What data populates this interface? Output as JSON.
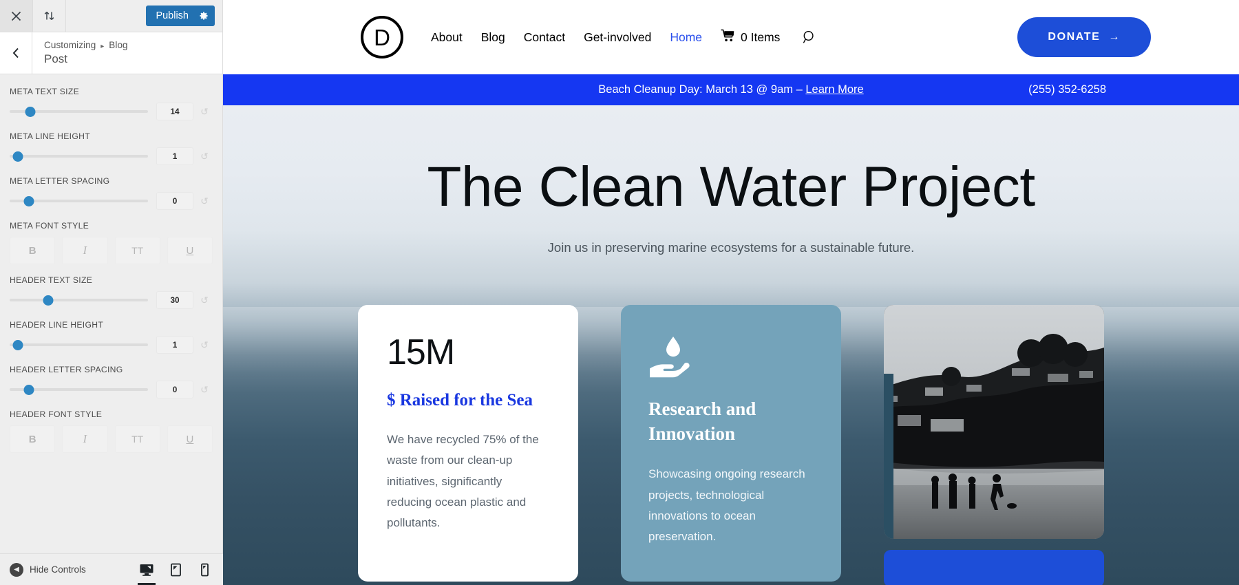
{
  "customizer": {
    "topbar": {
      "close_icon": "close-icon",
      "devices_icon": "collapse-expand-icon",
      "publish_label": "Publish",
      "gear_icon": "gear-icon"
    },
    "header": {
      "back_icon": "chevron-left-icon",
      "breadcrumb_root": "Customizing",
      "breadcrumb_separator": "▸",
      "breadcrumb_current": "Blog",
      "section_title": "Post"
    },
    "controls": [
      {
        "label": "META TEXT SIZE",
        "value": "14",
        "knob_pct": 15
      },
      {
        "label": "META LINE HEIGHT",
        "value": "1",
        "knob_pct": 6
      },
      {
        "label": "META LETTER SPACING",
        "value": "0",
        "knob_pct": 14
      }
    ],
    "meta_font_style": {
      "label": "META FONT STYLE",
      "buttons": [
        "B",
        "I",
        "TT",
        "U"
      ]
    },
    "header_controls": [
      {
        "label": "HEADER TEXT SIZE",
        "value": "30",
        "knob_pct": 28
      },
      {
        "label": "HEADER LINE HEIGHT",
        "value": "1",
        "knob_pct": 6
      },
      {
        "label": "HEADER LETTER SPACING",
        "value": "0",
        "knob_pct": 14
      }
    ],
    "header_font_style": {
      "label": "HEADER FONT STYLE",
      "buttons": [
        "B",
        "I",
        "TT",
        "U"
      ]
    },
    "reset_icon": "reset-undo-icon",
    "footer": {
      "hide_controls_label": "Hide Controls",
      "collapse_icon": "collapse-left-icon",
      "devices": [
        {
          "name": "desktop",
          "icon": "desktop-icon",
          "active": true
        },
        {
          "name": "tablet",
          "icon": "tablet-icon",
          "active": false
        },
        {
          "name": "mobile",
          "icon": "mobile-icon",
          "active": false
        }
      ]
    }
  },
  "site": {
    "logo_letter": "D",
    "nav": [
      {
        "label": "About",
        "active": false
      },
      {
        "label": "Blog",
        "active": false
      },
      {
        "label": "Contact",
        "active": false
      },
      {
        "label": "Get-involved",
        "active": false
      },
      {
        "label": "Home",
        "active": true
      }
    ],
    "cart": {
      "icon": "cart-icon",
      "label": "0 Items"
    },
    "search_icon": "search-icon",
    "donate": {
      "label": "DONATE",
      "arrow": "→",
      "color": "#1d4ed8"
    },
    "announcement": {
      "text_before": "Beach Cleanup Day: March 13 @ 9am – ",
      "link_label": "Learn More",
      "phone": "(255) 352-6258",
      "bg_color": "#1537f2"
    },
    "hero": {
      "title": "The Clean Water Project",
      "subtitle": "Join us in preserving marine ecosystems for a sustainable future."
    },
    "cards": {
      "stat": {
        "value": "15M",
        "label": "$ Raised for the Sea",
        "label_color": "#1937e0",
        "body": "We have recycled 75% of the waste from our clean-up initiatives, significantly reducing ocean plastic and pollutants."
      },
      "feature": {
        "icon": "hand-water-drop-icon",
        "title": "Research and Innovation",
        "body": "Showcasing ongoing research projects, technological innovations to ocean preservation.",
        "bg_color": "#74a3ba"
      },
      "photo": {
        "alt": "beach-silhouettes-photo"
      }
    }
  }
}
